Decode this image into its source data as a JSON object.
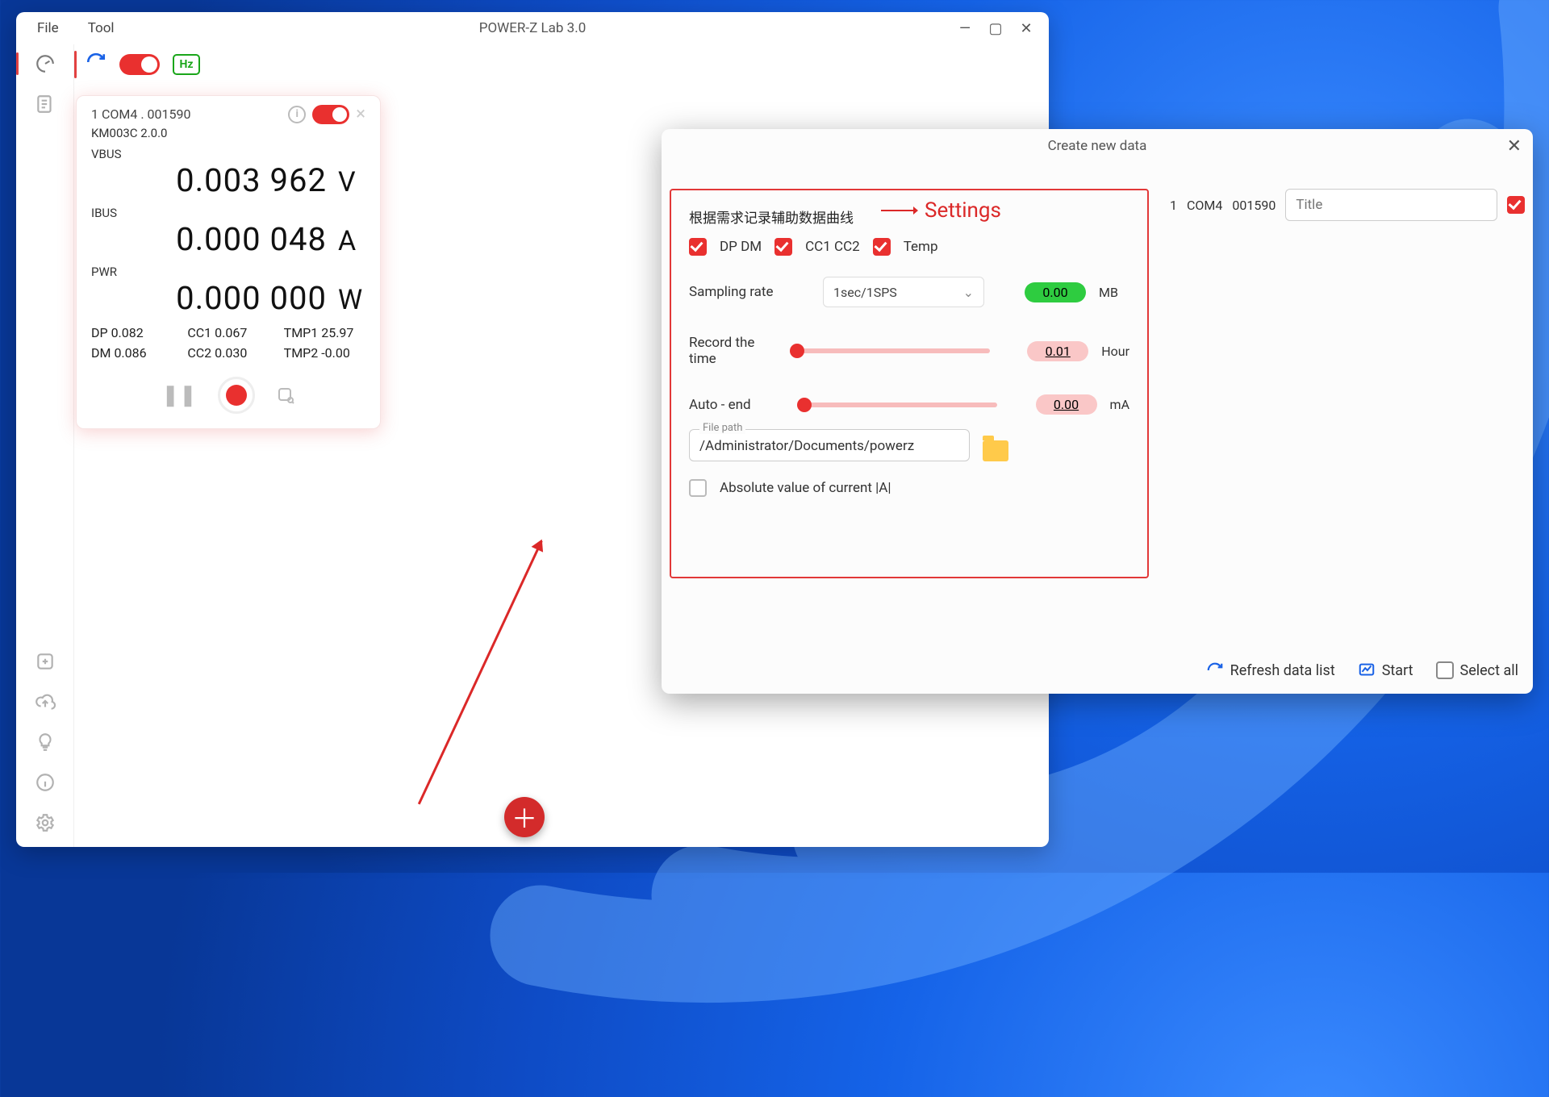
{
  "app": {
    "title": "POWER-Z Lab 3.0",
    "menu": {
      "file": "File",
      "tool": "Tool"
    },
    "toolbar": {
      "hz": "Hz"
    }
  },
  "device": {
    "header": "1   COM4  . 001590",
    "model": "KM003C 2.0.0",
    "vbus": {
      "label": "VBUS",
      "value": "0.003 962",
      "unit": "V"
    },
    "ibus": {
      "label": "IBUS",
      "value": "0.000 048",
      "unit": "A"
    },
    "pwr": {
      "label": "PWR",
      "value": "0.000 000",
      "unit": "W"
    },
    "sec": {
      "dp": "DP 0.082",
      "cc1": "CC1 0.067",
      "tmp1": "TMP1 25.97",
      "dm": "DM 0.086",
      "cc2": "CC2 0.030",
      "tmp2": "TMP2 -0.00"
    }
  },
  "dialog": {
    "title": "Create new data",
    "annot_settings": "Settings",
    "header": "根据需求记录辅助数据曲线",
    "opt_dp": "DP DM",
    "opt_cc": "CC1 CC2",
    "opt_temp": "Temp",
    "sampling_label": "Sampling rate",
    "sampling_value": "1sec/1SPS",
    "size_value": "0.00",
    "size_unit": "MB",
    "record_label": "Record the time",
    "record_value": "0.01",
    "record_unit": "Hour",
    "auto_label": "Auto - end",
    "auto_value": "0.00",
    "auto_unit": "mA",
    "filepath_legend": "File path",
    "filepath_value": "/Administrator/Documents/powerz",
    "abs_label": "Absolute value of current |A|",
    "right": {
      "index": "1",
      "port": "COM4",
      "serial": "001590",
      "title_placeholder": "Title"
    },
    "footer": {
      "refresh": "Refresh data list",
      "start": "Start",
      "select_all": "Select all"
    }
  }
}
